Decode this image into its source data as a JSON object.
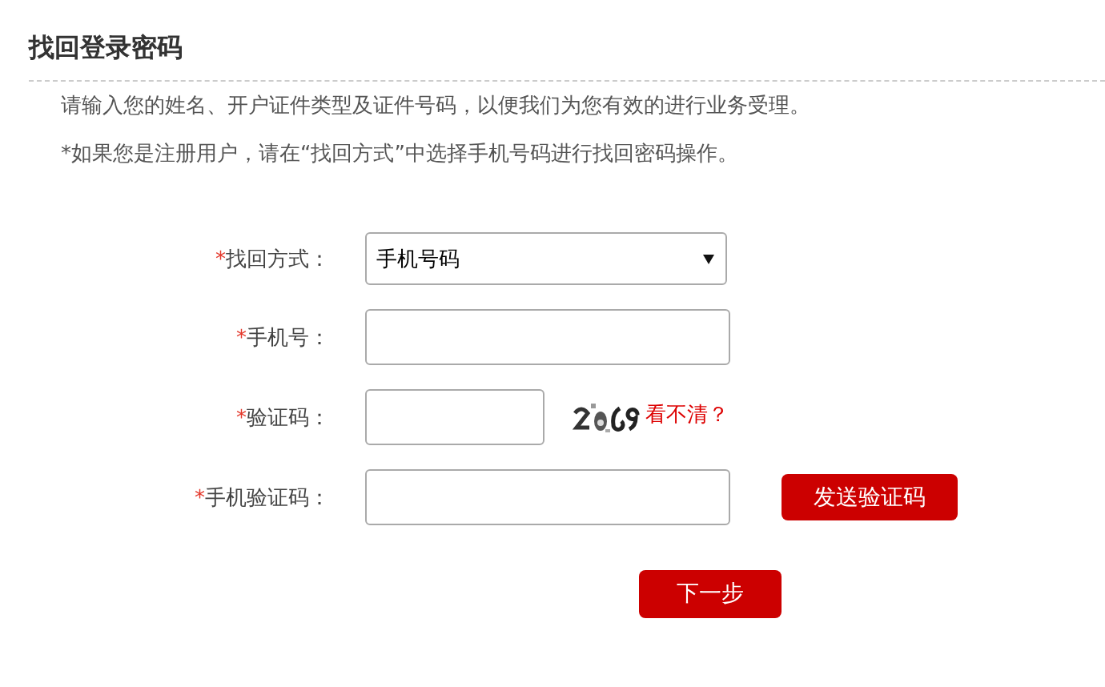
{
  "title": "找回登录密码",
  "notes": [
    "请输入您的姓名、开户证件类型及证件号码，以便我们为您有效的进行业务受理。",
    "*如果您是注册用户，请在“找回方式”中选择手机号码进行找回密码操作。"
  ],
  "fields": [
    {
      "kind": "select",
      "marker": "*",
      "label": "找回方式：",
      "value": "手机号码"
    },
    {
      "kind": "input",
      "marker": "*",
      "label": "手机号："
    },
    {
      "kind": "captcha",
      "marker": "*",
      "label": "验证码：",
      "link": "看不清？"
    },
    {
      "kind": "sms",
      "marker": "*",
      "label": "手机验证码：",
      "button": "发送验证码"
    }
  ],
  "next_button": "下一步"
}
